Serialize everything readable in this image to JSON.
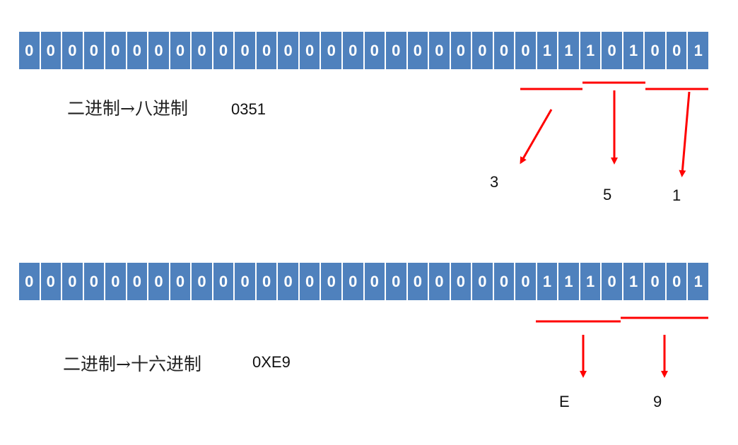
{
  "octal": {
    "bits": [
      "0",
      "0",
      "0",
      "0",
      "0",
      "0",
      "0",
      "0",
      "0",
      "0",
      "0",
      "0",
      "0",
      "0",
      "0",
      "0",
      "0",
      "0",
      "0",
      "0",
      "0",
      "0",
      "0",
      "0",
      "1",
      "1",
      "1",
      "0",
      "1",
      "0",
      "0",
      "1"
    ],
    "label": "二进制→八进制",
    "value": "0351",
    "digits": [
      "3",
      "5",
      "1"
    ]
  },
  "hex": {
    "bits": [
      "0",
      "0",
      "0",
      "0",
      "0",
      "0",
      "0",
      "0",
      "0",
      "0",
      "0",
      "0",
      "0",
      "0",
      "0",
      "0",
      "0",
      "0",
      "0",
      "0",
      "0",
      "0",
      "0",
      "0",
      "1",
      "1",
      "1",
      "0",
      "1",
      "0",
      "0",
      "1"
    ],
    "label": "二进制→十六进制",
    "value": "0XE9",
    "digits": [
      "E",
      "9"
    ]
  },
  "colors": {
    "cell": "#4f81bd",
    "arrow": "#ff0000"
  }
}
